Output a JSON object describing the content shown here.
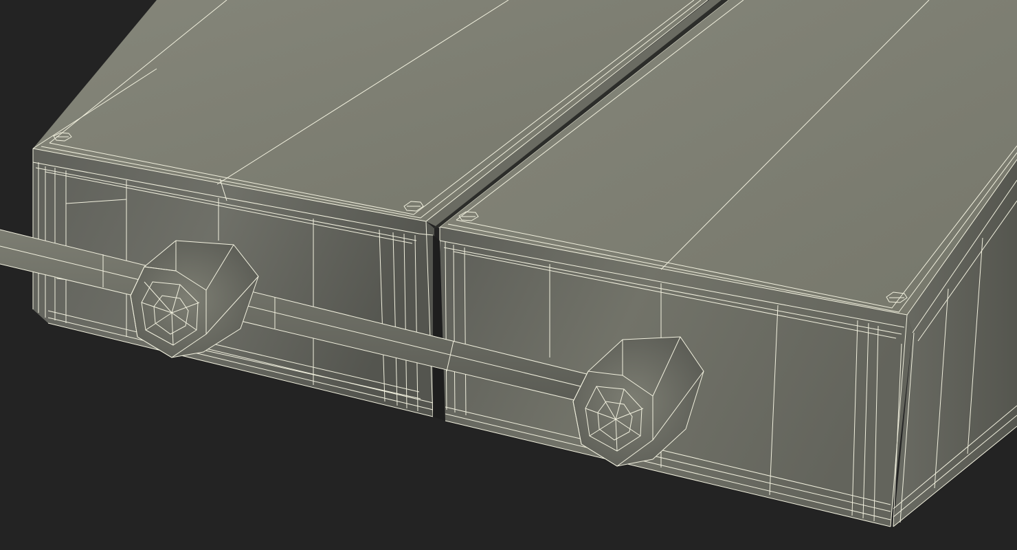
{
  "scene": {
    "background_color": "#232323",
    "surface_color": "#7a7b6e",
    "surface_dark_color": "#4f504a",
    "wire_color": "#f2f1df",
    "objects": [
      "battery-module-left",
      "battery-module-right",
      "connector-cable",
      "connector-left",
      "connector-right"
    ]
  }
}
